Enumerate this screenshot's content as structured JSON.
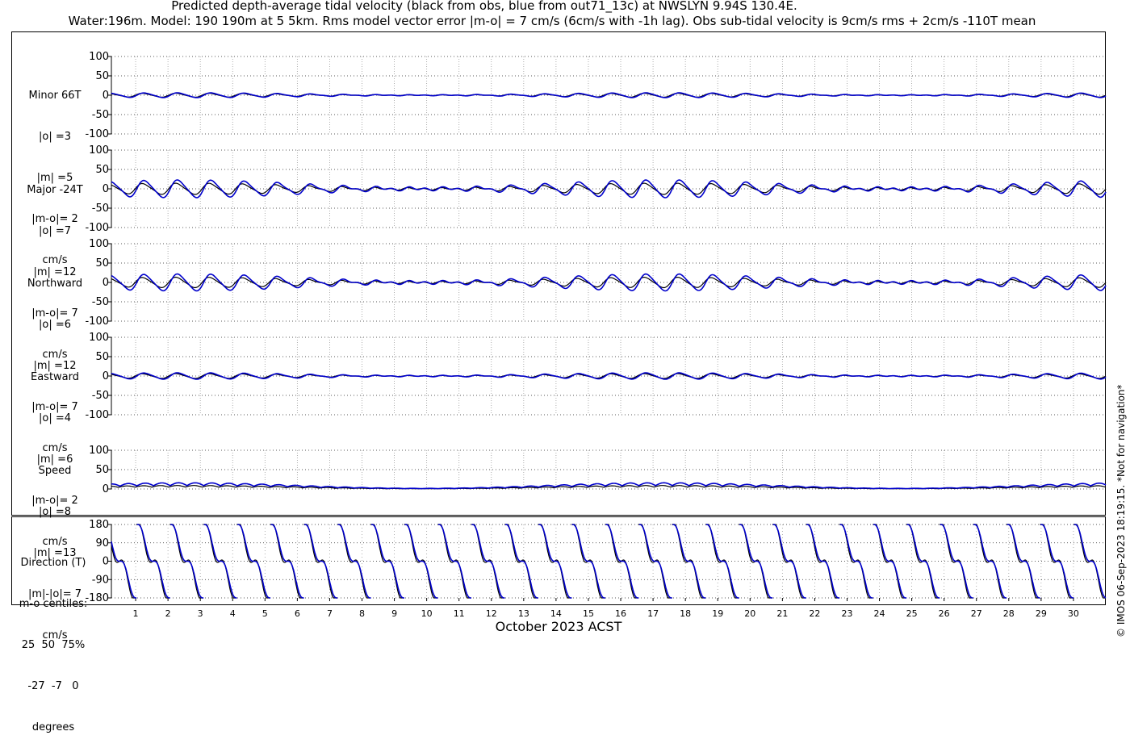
{
  "title_line1": "Predicted depth-average tidal velocity (black from obs, blue from out71_13c) at NWSLYN 9.94S 130.4E.",
  "title_line2": "Water:196m. Model: 190 190m at 5 5km. Rms model vector error |m-o| = 7 cm/s (6cm/s with -1h lag). Obs sub-tidal velocity is 9cm/s rms + 2cm/s -110T mean",
  "xlabel": "October 2023 ACST",
  "footer": "© IMOS 06-Sep-2023 18:19:15. *Not for navigation*",
  "colors": {
    "obs": "#000000",
    "model": "#0000cc",
    "grid": "#9a9a9a"
  },
  "chart_data": [
    {
      "type": "line",
      "panel": "Minor 66T",
      "labels": [
        "Minor 66T",
        "|o| =3",
        "|m| =5",
        "|m-o|= 2",
        "cm/s"
      ],
      "ylim": [
        -100,
        100
      ],
      "yticks": [
        "100",
        "50",
        "0",
        "-50",
        "-100"
      ],
      "grid": true,
      "amplitude": {
        "obs": 5,
        "model": 6
      },
      "series": [
        {
          "name": "obs",
          "color": "#000000"
        },
        {
          "name": "model",
          "color": "#0000cc"
        }
      ]
    },
    {
      "type": "line",
      "panel": "Major -24T",
      "labels": [
        "Major -24T",
        "|o| =7",
        "|m| =12",
        "|m-o|= 7",
        "cm/s"
      ],
      "ylim": [
        -100,
        100
      ],
      "yticks": [
        "100",
        "50",
        "0",
        "-50",
        "-100"
      ],
      "grid": true,
      "amplitude": {
        "obs": 14,
        "model": 22
      },
      "series": [
        {
          "name": "obs",
          "color": "#000000"
        },
        {
          "name": "model",
          "color": "#0000cc"
        }
      ]
    },
    {
      "type": "line",
      "panel": "Northward",
      "labels": [
        "Northward",
        "|o| =6",
        "|m| =12",
        "|m-o|= 7",
        "cm/s"
      ],
      "ylim": [
        -100,
        100
      ],
      "yticks": [
        "100",
        "50",
        "0",
        "-50",
        "-100"
      ],
      "grid": true,
      "amplitude": {
        "obs": 13,
        "model": 21
      },
      "series": [
        {
          "name": "obs",
          "color": "#000000"
        },
        {
          "name": "model",
          "color": "#0000cc"
        }
      ]
    },
    {
      "type": "line",
      "panel": "Eastward",
      "labels": [
        "Eastward",
        "|o| =4",
        "|m| =6",
        "|m-o|= 2",
        "cm/s"
      ],
      "ylim": [
        -100,
        100
      ],
      "yticks": [
        "100",
        "50",
        "0",
        "-50",
        "-100"
      ],
      "grid": true,
      "amplitude": {
        "obs": 6,
        "model": 8
      },
      "series": [
        {
          "name": "obs",
          "color": "#000000"
        },
        {
          "name": "model",
          "color": "#0000cc"
        }
      ]
    },
    {
      "type": "line",
      "panel": "Speed",
      "labels": [
        "Speed",
        "|o| =8",
        "|m| =13",
        "|m|-|o|= 7",
        "cm/s"
      ],
      "ylim": [
        0,
        100
      ],
      "yticks": [
        "100",
        "50",
        "0"
      ],
      "grid": true,
      "amplitude": {
        "obs": 9,
        "model": 16
      },
      "series": [
        {
          "name": "obs",
          "color": "#000000"
        },
        {
          "name": "model",
          "color": "#0000cc"
        }
      ]
    },
    {
      "type": "line",
      "panel": "Direction (T)",
      "labels": [
        "Direction (T)",
        "m-o centiles:",
        "25  50  75%",
        "-27  -7   0",
        "degrees"
      ],
      "ylim": [
        -180,
        180
      ],
      "yticks": [
        "180",
        "90",
        "0",
        "-90",
        "-180"
      ],
      "grid": true,
      "series": [
        {
          "name": "obs",
          "color": "#000000"
        },
        {
          "name": "model",
          "color": "#0000cc"
        }
      ]
    }
  ],
  "x_ticks": [
    "1",
    "2",
    "3",
    "4",
    "5",
    "6",
    "7",
    "8",
    "9",
    "10",
    "11",
    "12",
    "13",
    "14",
    "15",
    "16",
    "17",
    "18",
    "19",
    "20",
    "21",
    "22",
    "23",
    "24",
    "25",
    "26",
    "27",
    "28",
    "29",
    "30"
  ],
  "x_range_days": [
    0.25,
    31.0
  ]
}
